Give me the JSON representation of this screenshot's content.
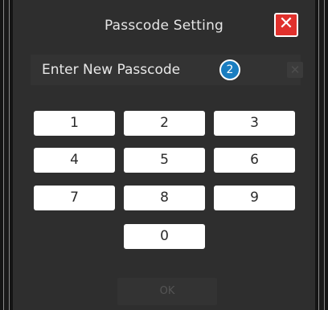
{
  "dialog": {
    "title": "Passcode Setting",
    "close_icon": "close-icon",
    "entry_label": "Enter New Passcode",
    "step_number": "2",
    "clear_icon": "clear-icon",
    "ok_label": "OK"
  },
  "keypad": {
    "keys": [
      "1",
      "2",
      "3",
      "4",
      "5",
      "6",
      "7",
      "8",
      "9",
      "0"
    ]
  },
  "colors": {
    "close_button": "#e0302c",
    "step_badge": "#1a7dc0",
    "key_background": "#ffffff",
    "dialog_background": "#2e2e2e"
  }
}
